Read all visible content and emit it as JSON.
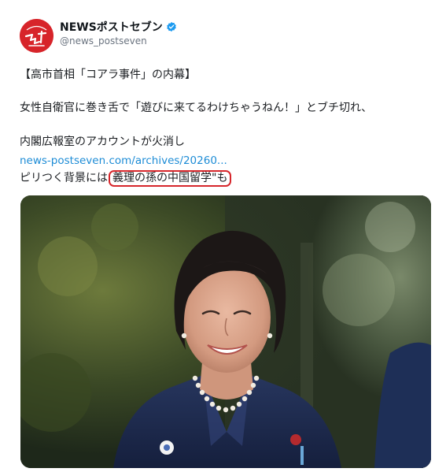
{
  "account": {
    "display_name": "NEWSポストセブン",
    "handle": "@news_postseven",
    "avatar_label": "NEWSポストセブン logo",
    "verified": true
  },
  "tweet": {
    "line1": "【高市首相「コアラ事件」の内幕】",
    "line2": "女性自衛官に巻き舌で「遊びに来てるわけちゃうねん！」とブチ切れ、",
    "line3": "内閣広報室のアカウントが火消し",
    "link_text": "news-postseven.com/archives/20260...",
    "line5_prefix": "ピリつく背景には",
    "line5_highlight": "義理の孫の中国留学\"も"
  },
  "media": {
    "type": "photo"
  },
  "colors": {
    "brand_red": "#d7242a",
    "verified_blue": "#1d9bf0",
    "link_blue": "#1d8cd6",
    "highlight_circle": "#d6262b",
    "text": "#0f1419",
    "muted": "#6b7480"
  },
  "icons": {
    "avatar": "news-postseven-logo",
    "verified": "verified-badge-icon"
  }
}
